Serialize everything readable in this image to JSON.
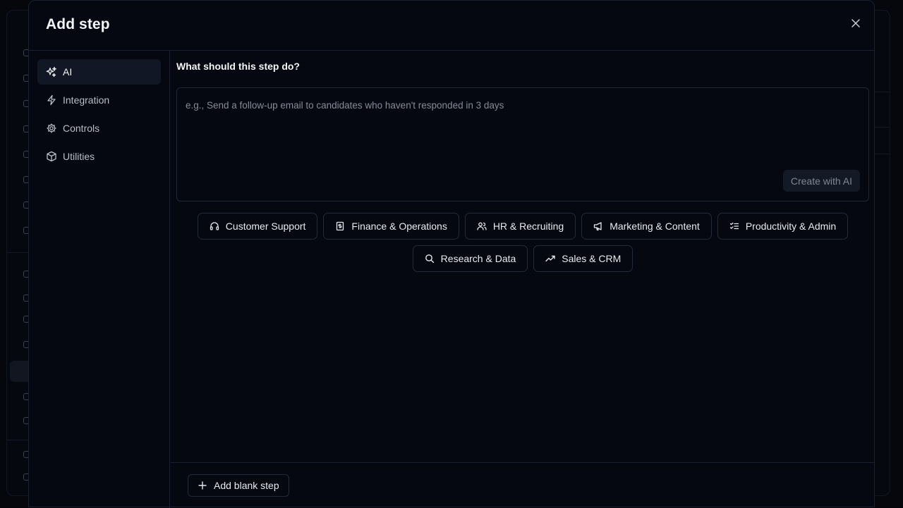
{
  "modal": {
    "title": "Add step",
    "close_icon": "close-icon"
  },
  "nav": {
    "items": [
      {
        "label": "AI",
        "icon": "sparkles-icon",
        "active": true
      },
      {
        "label": "Integration",
        "icon": "lightning-icon",
        "active": false
      },
      {
        "label": "Controls",
        "icon": "gear-icon",
        "active": false
      },
      {
        "label": "Utilities",
        "icon": "box-icon",
        "active": false
      }
    ]
  },
  "prompt": {
    "label": "What should this step do?",
    "placeholder": "e.g., Send a follow-up email to candidates who haven't responded in 3 days",
    "value": "",
    "create_label": "Create with AI"
  },
  "categories": [
    {
      "label": "Customer Support",
      "icon": "headphones-icon"
    },
    {
      "label": "Finance & Operations",
      "icon": "receipt-icon"
    },
    {
      "label": "HR & Recruiting",
      "icon": "users-icon"
    },
    {
      "label": "Marketing & Content",
      "icon": "megaphone-icon"
    },
    {
      "label": "Productivity & Admin",
      "icon": "checklist-icon"
    },
    {
      "label": "Research & Data",
      "icon": "search-icon"
    },
    {
      "label": "Sales & CRM",
      "icon": "trending-up-icon"
    }
  ],
  "footer": {
    "add_blank_label": "Add blank step"
  },
  "colors": {
    "background": "#020409",
    "modal": "#050811",
    "border": "#1b2130",
    "active_nav": "#111725",
    "muted_text": "#858c98"
  }
}
